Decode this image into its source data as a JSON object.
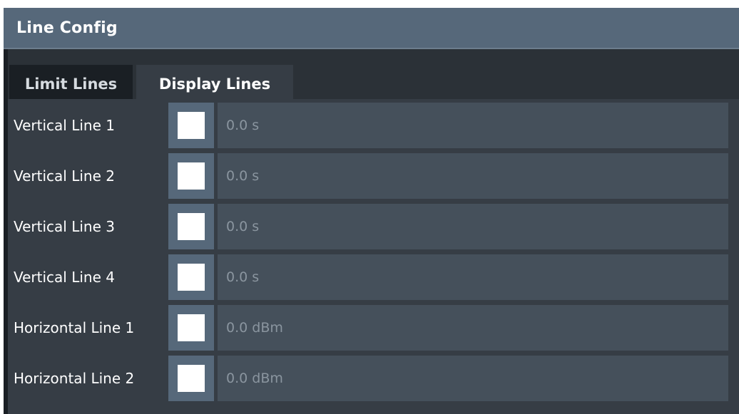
{
  "dialog": {
    "title": "Line Config"
  },
  "tabs": [
    {
      "label": "Limit Lines"
    },
    {
      "label": "Display Lines"
    }
  ],
  "lines": [
    {
      "label": "Vertical Line 1",
      "value": "0.0 s"
    },
    {
      "label": "Vertical Line 2",
      "value": "0.0 s"
    },
    {
      "label": "Vertical Line 3",
      "value": "0.0 s"
    },
    {
      "label": "Vertical Line 4",
      "value": "0.0 s"
    },
    {
      "label": "Horizontal Line 1",
      "value": "0.0 dBm"
    },
    {
      "label": "Horizontal Line 2",
      "value": "0.0 dBm"
    }
  ]
}
